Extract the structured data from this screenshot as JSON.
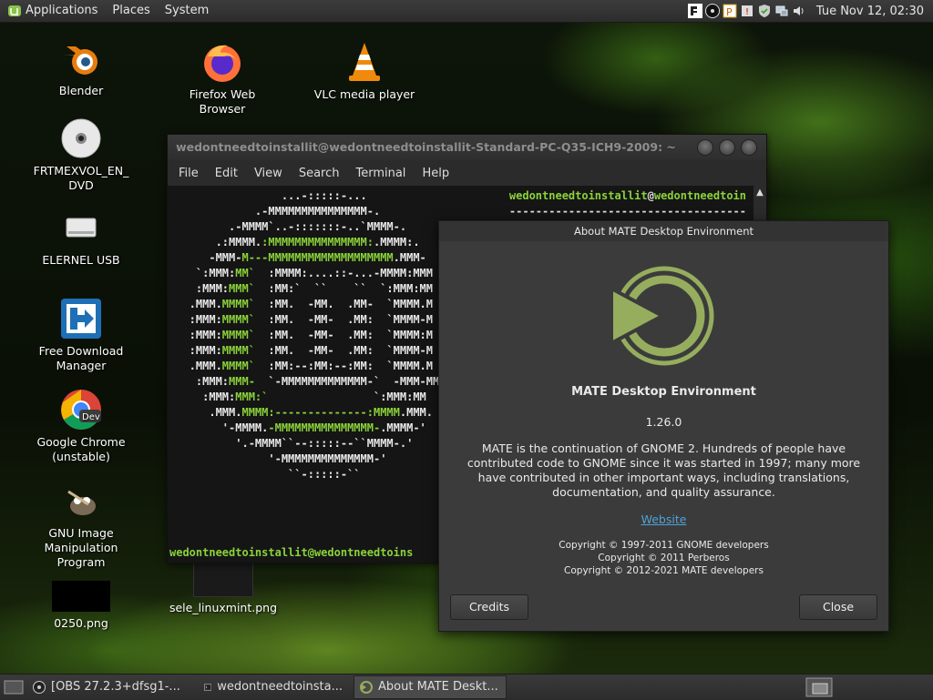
{
  "top_panel": {
    "menus": [
      "Applications",
      "Places",
      "System"
    ],
    "clock": "Tue Nov 12, 02:30",
    "tray_icons": [
      "fdm-icon",
      "obs-icon",
      "parcellite-icon",
      "update-icon",
      "shield-icon",
      "network-icon",
      "volume-icon"
    ]
  },
  "desktop_icons": [
    {
      "label": "Blender",
      "icon": "blender-icon"
    },
    {
      "label": "Firefox Web Browser",
      "icon": "firefox-icon"
    },
    {
      "label": "VLC media player",
      "icon": "vlc-icon"
    },
    {
      "label": "FRTMEXVOL_EN_ DVD",
      "icon": "dvd-icon"
    },
    {
      "label": "ELERNEL USB",
      "icon": "usb-drive-icon"
    },
    {
      "label": "Free Download Manager",
      "icon": "fdm-icon"
    },
    {
      "label": "Google Chrome (unstable)",
      "icon": "chrome-dev-icon"
    },
    {
      "label": "GNU Image Manipulation Program",
      "icon": "gimp-icon"
    },
    {
      "label": "0250.png",
      "icon": "image-thumbnail"
    },
    {
      "label": "sele_linuxmint.png",
      "icon": "image-thumbnail"
    }
  ],
  "terminal": {
    "title": "wedontneedtoinstallit@wedontneedtoinstallit-Standard-PC-Q35-ICH9-2009: ~",
    "menu": [
      "File",
      "Edit",
      "View",
      "Search",
      "Terminal",
      "Help"
    ],
    "prompt_user": "wedontneedtoinstallit",
    "prompt_host": "wedontneedtoin",
    "dashes": "------------------------------------",
    "bottom_prompt": "wedontneedtoinstallit@wedontneedtoins"
  },
  "about": {
    "title": "About MATE Desktop Environment",
    "name": "MATE Desktop Environment",
    "version": "1.26.0",
    "description": "MATE is the continuation of GNOME 2. Hundreds of people have contributed code to GNOME since it was started in 1997; many more have contributed in other important ways, including translations, documentation, and quality assurance.",
    "website": "Website",
    "copyright": [
      "Copyright © 1997-2011 GNOME developers",
      "Copyright © 2011 Perberos",
      "Copyright © 2012-2021 MATE developers"
    ],
    "credits_label": "Credits",
    "close_label": "Close"
  },
  "taskbar": [
    {
      "label": "[OBS 27.2.3+dfsg1-...",
      "icon": "obs-icon"
    },
    {
      "label": "wedontneedtoinsta...",
      "icon": "terminal-icon"
    },
    {
      "label": "About MATE Deskt...",
      "icon": "mate-icon"
    }
  ]
}
